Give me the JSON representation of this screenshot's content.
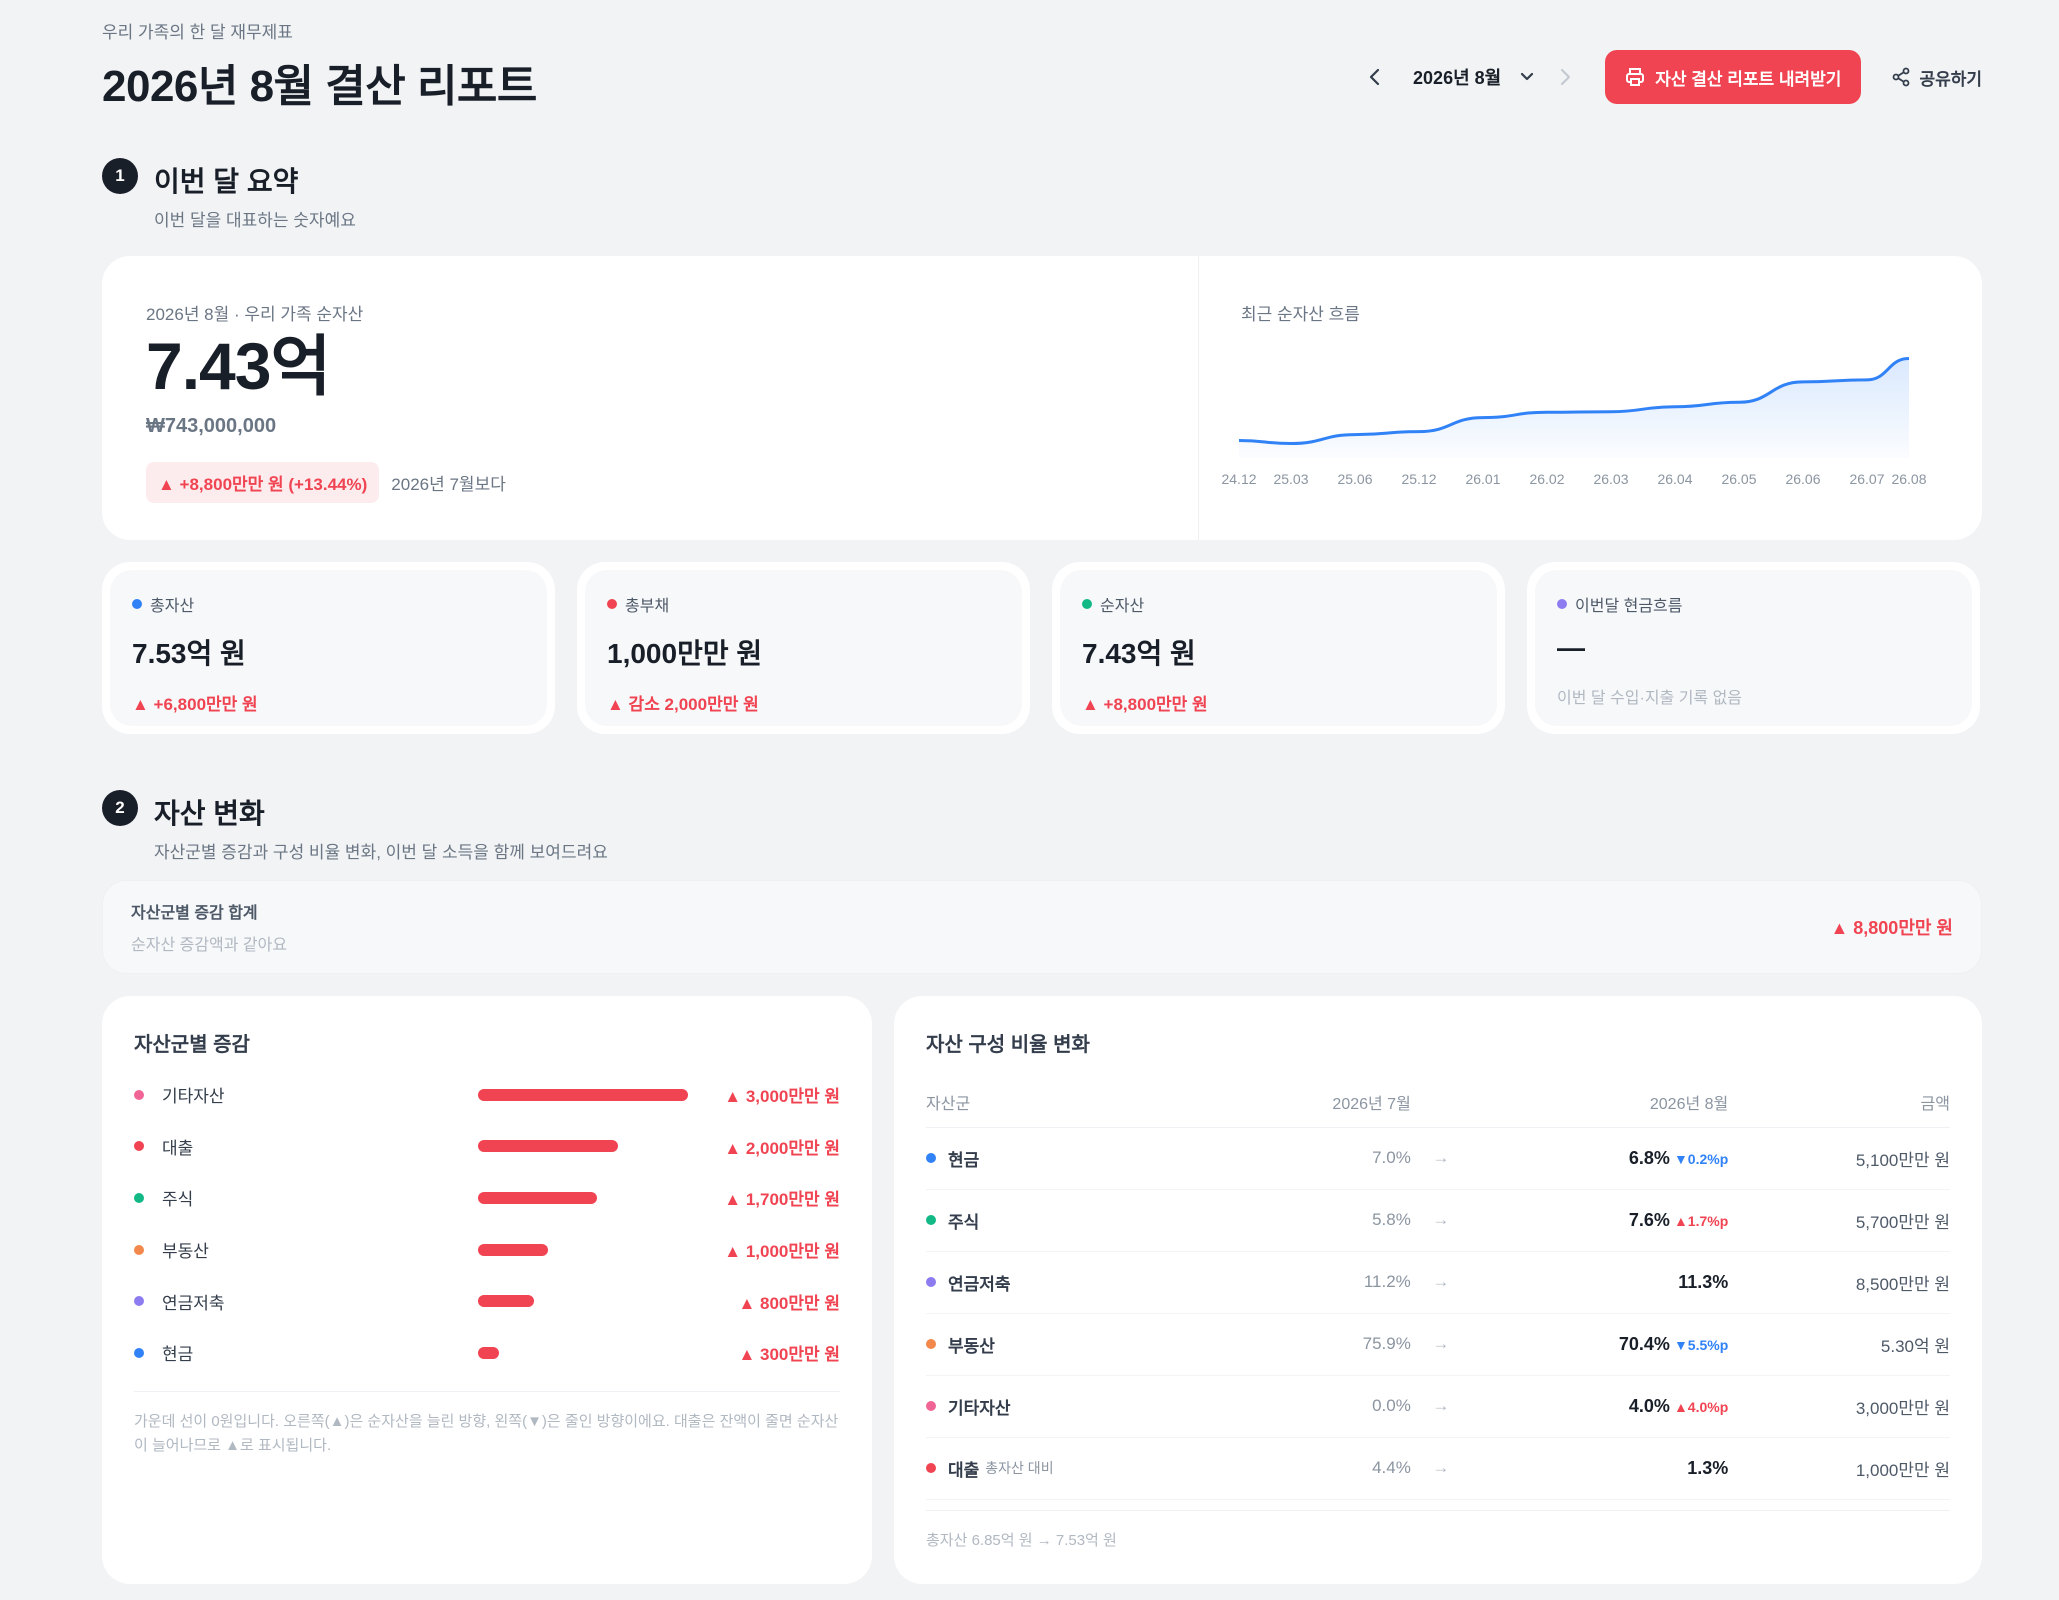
{
  "header": {
    "eyebrow": "우리 가족의 한 달 재무제표",
    "title": "2026년 8월 결산 리포트",
    "month_selector": "2026년 8월",
    "download_label": "자산 결산 리포트 내려받기",
    "share_label": "공유하기"
  },
  "section1": {
    "num": "1",
    "title": "이번 달 요약",
    "desc": "이번 달을 대표하는 숫자예요"
  },
  "summary": {
    "caption": "2026년 8월 · 우리 가족 순자산",
    "big_value": "7.43억",
    "won_value": "₩743,000,000",
    "change": "▲ +8,800만만 원 (+13.44%)",
    "since": "2026년 7월보다",
    "spark_title": "최근 순자산 흐름"
  },
  "chart_data": {
    "type": "area",
    "x": [
      "24.12",
      "25.03",
      "25.06",
      "25.12",
      "26.01",
      "26.02",
      "26.03",
      "26.04",
      "26.05",
      "26.06",
      "26.07",
      "26.08"
    ],
    "values": [
      5.78,
      5.72,
      5.9,
      5.96,
      6.24,
      6.35,
      6.36,
      6.46,
      6.55,
      6.96,
      7.0,
      7.43
    ],
    "title": "최근 순자산 흐름",
    "color": "#3182f6",
    "grid": false
  },
  "kpis": [
    {
      "label": "총자산",
      "color": "#3182f6",
      "value": "7.53억 원",
      "delta": "▲ +6,800만만 원"
    },
    {
      "label": "총부채",
      "color": "#f04452",
      "value": "1,000만만 원",
      "delta": "▲ 감소 2,000만만 원"
    },
    {
      "label": "순자산",
      "color": "#12b886",
      "value": "7.43억 원",
      "delta": "▲ +8,800만만 원"
    },
    {
      "label": "이번달 현금흐름",
      "color": "#8c7cf0",
      "value": "—",
      "muted": "이번 달 수입·지출 기록 없음"
    }
  ],
  "section2": {
    "num": "2",
    "title": "자산 변화",
    "desc": "자산군별 증감과 구성 비율 변화, 이번 달 소득을 함께 보여드려요"
  },
  "sumbar": {
    "title": "자산군별 증감 합계",
    "sub": "순자산 증감액과 같아요",
    "value": "▲ 8,800만만 원"
  },
  "delta_card": {
    "title": "자산군별 증감",
    "rows": [
      {
        "name": "기타자산",
        "color": "#f06595",
        "pct": 1.0,
        "value": "▲ 3,000만만 원"
      },
      {
        "name": "대출",
        "color": "#f04452",
        "pct": 0.667,
        "value": "▲ 2,000만만 원"
      },
      {
        "name": "주식",
        "color": "#12b886",
        "pct": 0.567,
        "value": "▲ 1,700만만 원"
      },
      {
        "name": "부동산",
        "color": "#f2884b",
        "pct": 0.333,
        "value": "▲ 1,000만만 원"
      },
      {
        "name": "연금저축",
        "color": "#8c7cf0",
        "pct": 0.267,
        "value": "▲ 800만만 원"
      },
      {
        "name": "현금",
        "color": "#3182f6",
        "pct": 0.1,
        "value": "▲ 300만만 원"
      }
    ],
    "note": "가운데 선이 0원입니다. 오른쪽(▲)은 순자산을 늘린 방향, 왼쪽(▼)은 줄인 방향이에요. 대출은 잔액이 줄면 순자산이 늘어나므로 ▲로 표시됩니다."
  },
  "ratio_card": {
    "title": "자산 구성 비율 변화",
    "headers": [
      "자산군",
      "2026년 7월",
      "2026년 8월",
      "금액"
    ],
    "rows": [
      {
        "name": "현금",
        "color": "#3182f6",
        "prev": "7.0%",
        "cur": "6.8%",
        "chg": "▼0.2%p",
        "dir": "down",
        "amount": "5,100만만 원"
      },
      {
        "name": "주식",
        "color": "#12b886",
        "prev": "5.8%",
        "cur": "7.6%",
        "chg": "▲1.7%p",
        "dir": "up",
        "amount": "5,700만만 원"
      },
      {
        "name": "연금저축",
        "color": "#8c7cf0",
        "prev": "11.2%",
        "cur": "11.3%",
        "chg": "",
        "dir": "",
        "amount": "8,500만만 원"
      },
      {
        "name": "부동산",
        "color": "#f2884b",
        "prev": "75.9%",
        "cur": "70.4%",
        "chg": "▼5.5%p",
        "dir": "down",
        "amount": "5.30억 원"
      },
      {
        "name": "기타자산",
        "color": "#f06595",
        "prev": "0.0%",
        "cur": "4.0%",
        "chg": "▲4.0%p",
        "dir": "up",
        "amount": "3,000만만 원"
      },
      {
        "name": "대출",
        "sub": "총자산 대비",
        "color": "#f04452",
        "prev": "4.4%",
        "cur": "1.3%",
        "chg": "",
        "dir": "",
        "amount": "1,000만만 원"
      }
    ],
    "footer": "총자산 6.85억 원 → 7.53억 원"
  }
}
